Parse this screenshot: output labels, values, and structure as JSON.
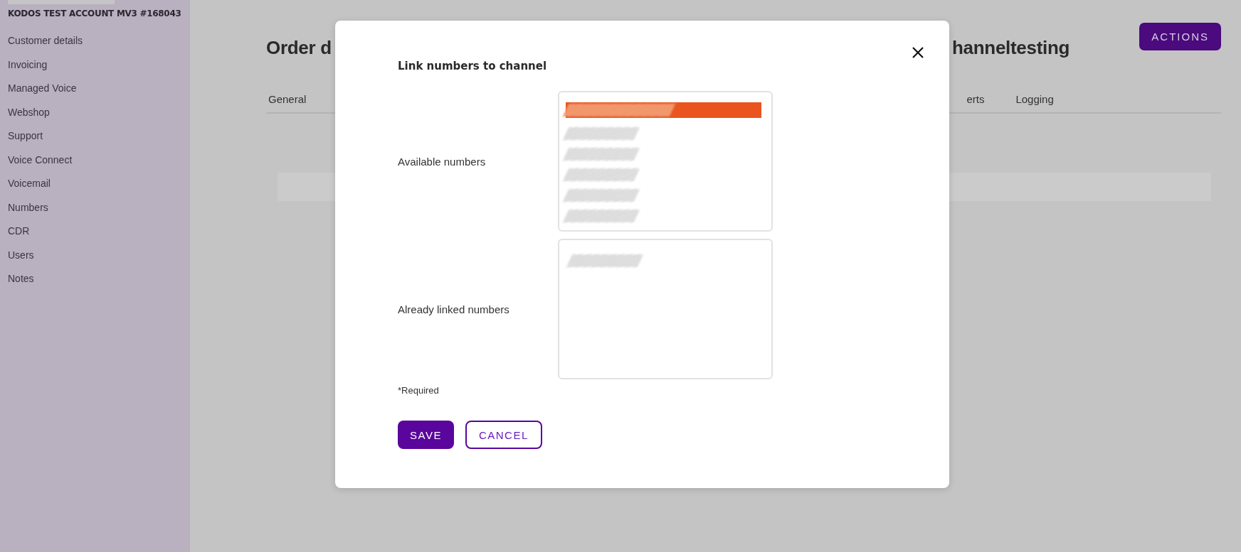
{
  "sidebar": {
    "account": "KODOS TEST ACCOUNT MV3 #168043",
    "items": [
      "Customer details",
      "Invoicing",
      "Managed Voice",
      "Webshop",
      "Support",
      "Voice Connect",
      "Voicemail",
      "Numbers",
      "CDR",
      "Users",
      "Notes"
    ]
  },
  "page": {
    "title_visible_start": "Order d",
    "title_visible_end": "hanneltesting",
    "actions_button": "ACTIONS",
    "tabs": [
      {
        "label": "General"
      },
      {
        "label": "erts"
      },
      {
        "label": "Logging"
      }
    ]
  },
  "dialog": {
    "title": "Link numbers to channel",
    "fields": [
      {
        "label": "Available numbers",
        "items": [
          {
            "selected": true
          },
          {
            "selected": false
          },
          {
            "selected": false
          },
          {
            "selected": false
          },
          {
            "selected": false
          },
          {
            "selected": false
          }
        ]
      },
      {
        "label": "Already linked numbers",
        "items": [
          {
            "selected": false
          }
        ]
      }
    ],
    "required_note": "*Required",
    "buttons": [
      {
        "kind": "primary",
        "label": "SAVE"
      },
      {
        "kind": "secondary",
        "label": "CANCEL"
      }
    ]
  }
}
